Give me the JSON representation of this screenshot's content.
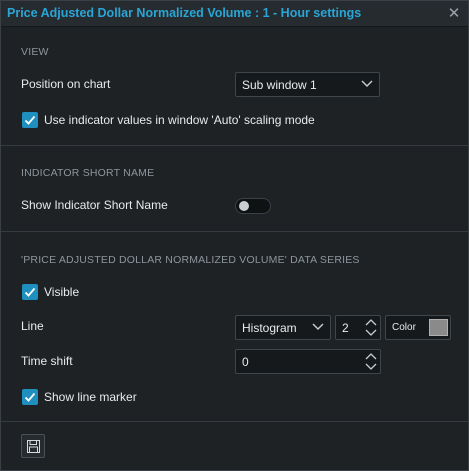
{
  "window": {
    "title": "Price Adjusted Dollar Normalized Volume : 1 - Hour settings",
    "close_icon": "close-icon"
  },
  "view": {
    "section_label": "VIEW",
    "position_label": "Position on chart",
    "position_value": "Sub window 1",
    "auto_scaling_label": "Use indicator values in window 'Auto' scaling mode",
    "auto_scaling_checked": true
  },
  "short_name": {
    "section_label": "INDICATOR SHORT NAME",
    "show_label": "Show Indicator Short Name",
    "show_enabled": false
  },
  "data_series": {
    "section_label": "'PRICE ADJUSTED DOLLAR NORMALIZED VOLUME' DATA SERIES",
    "visible_label": "Visible",
    "visible_checked": true,
    "line_label": "Line",
    "line_type": "Histogram",
    "line_width": "2",
    "color_label": "Color",
    "color_value": "#8a8a8a",
    "time_shift_label": "Time shift",
    "time_shift_value": "0",
    "line_marker_label": "Show line marker",
    "line_marker_checked": true
  },
  "footer": {
    "save_icon": "save-icon"
  },
  "colors": {
    "accent": "#29a6d6",
    "checkbox": "#1f8fc0",
    "background": "#1e2225"
  }
}
